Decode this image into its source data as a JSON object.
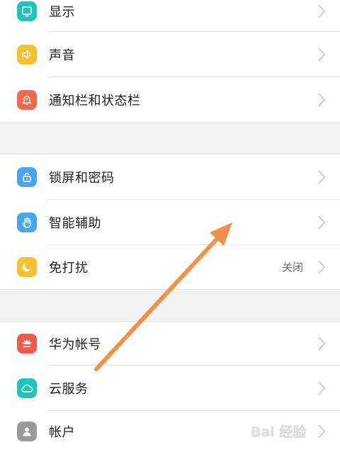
{
  "settings": {
    "items": [
      {
        "id": "display",
        "label": "显示",
        "icon": "display-icon",
        "color": "#22c4b8"
      },
      {
        "id": "sound",
        "label": "声音",
        "icon": "speaker-icon",
        "color": "#f6c032"
      },
      {
        "id": "notifications",
        "label": "通知栏和状态栏",
        "icon": "bell-icon",
        "color": "#ef6a4c"
      },
      {
        "id": "lock",
        "label": "锁屏和密码",
        "icon": "lock-icon",
        "color": "#4aa5f0"
      },
      {
        "id": "assist",
        "label": "智能辅助",
        "icon": "hand-icon",
        "color": "#4aa5f0"
      },
      {
        "id": "dnd",
        "label": "免打扰",
        "value": "关闭",
        "icon": "moon-icon",
        "color": "#f6c032"
      },
      {
        "id": "huawei-account",
        "label": "华为帐号",
        "icon": "huawei-logo-icon",
        "color": "#ef5a4a"
      },
      {
        "id": "cloud",
        "label": "云服务",
        "icon": "cloud-icon",
        "color": "#22c4b8"
      },
      {
        "id": "accounts",
        "label": "帐户",
        "icon": "person-icon",
        "color": "#9a9a9a"
      }
    ]
  },
  "annotation": {
    "color": "#f0924a"
  },
  "watermark": {
    "text": "Bai 经验"
  }
}
